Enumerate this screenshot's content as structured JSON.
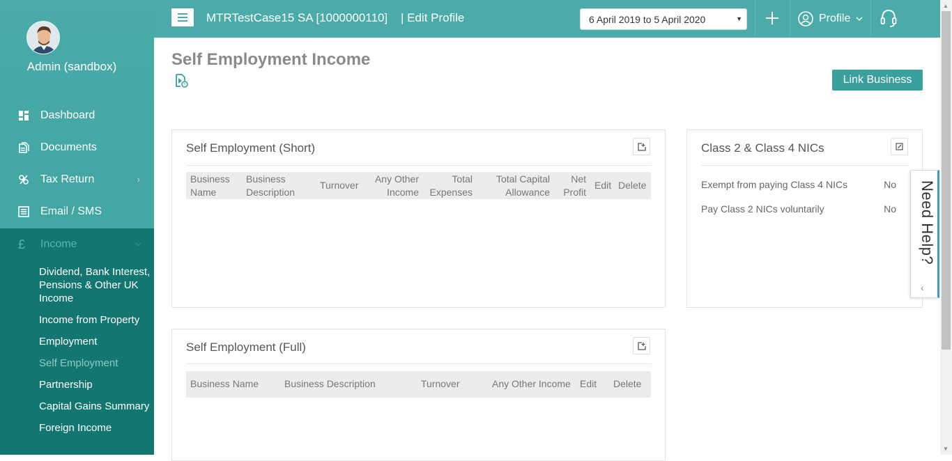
{
  "sidebar": {
    "user_name": "Admin (sandbox)",
    "items": [
      {
        "label": "Dashboard",
        "icon": "dashboard-icon"
      },
      {
        "label": "Documents",
        "icon": "documents-icon"
      },
      {
        "label": "Tax Return",
        "icon": "tax-return-icon"
      },
      {
        "label": "Email / SMS",
        "icon": "email-sms-icon"
      }
    ],
    "income": {
      "label": "Income",
      "icon": "pound-icon",
      "subitems": [
        "Dividend, Bank Interest, Pensions & Other UK Income",
        "Income from Property",
        "Employment",
        "Self Employment",
        "Partnership",
        "Capital Gains Summary",
        "Foreign Income"
      ],
      "active": "Self Employment"
    }
  },
  "topbar": {
    "client_title": "MTRTestCase15 SA [1000000110]",
    "edit_profile": "| Edit Profile",
    "period": "6 April 2019 to 5 April 2020",
    "profile_label": "Profile"
  },
  "page": {
    "title": "Self Employment Income",
    "link_business": "Link Business"
  },
  "short_panel": {
    "title": "Self Employment (Short)",
    "columns": [
      "Business Name",
      "Business Description",
      "Turnover",
      "Any Other Income",
      "Total Expenses",
      "Total Capital Allowance",
      "Net Profit",
      "Edit",
      "Delete"
    ]
  },
  "nics_panel": {
    "title": "Class 2 & Class 4 NICs",
    "rows": [
      {
        "label": "Exempt from paying Class 4 NICs",
        "value": "No"
      },
      {
        "label": "Pay Class 2 NICs voluntarily",
        "value": "No"
      }
    ]
  },
  "full_panel": {
    "title": "Self Employment (Full)",
    "columns": [
      "Business Name",
      "Business Description",
      "Turnover",
      "Any Other Income",
      "Edit",
      "Delete"
    ]
  },
  "need_help": "Need Help?",
  "colors": {
    "sidebar": "#4aaba8",
    "submenu": "#147671",
    "accent_button": "#3b9f9b"
  }
}
